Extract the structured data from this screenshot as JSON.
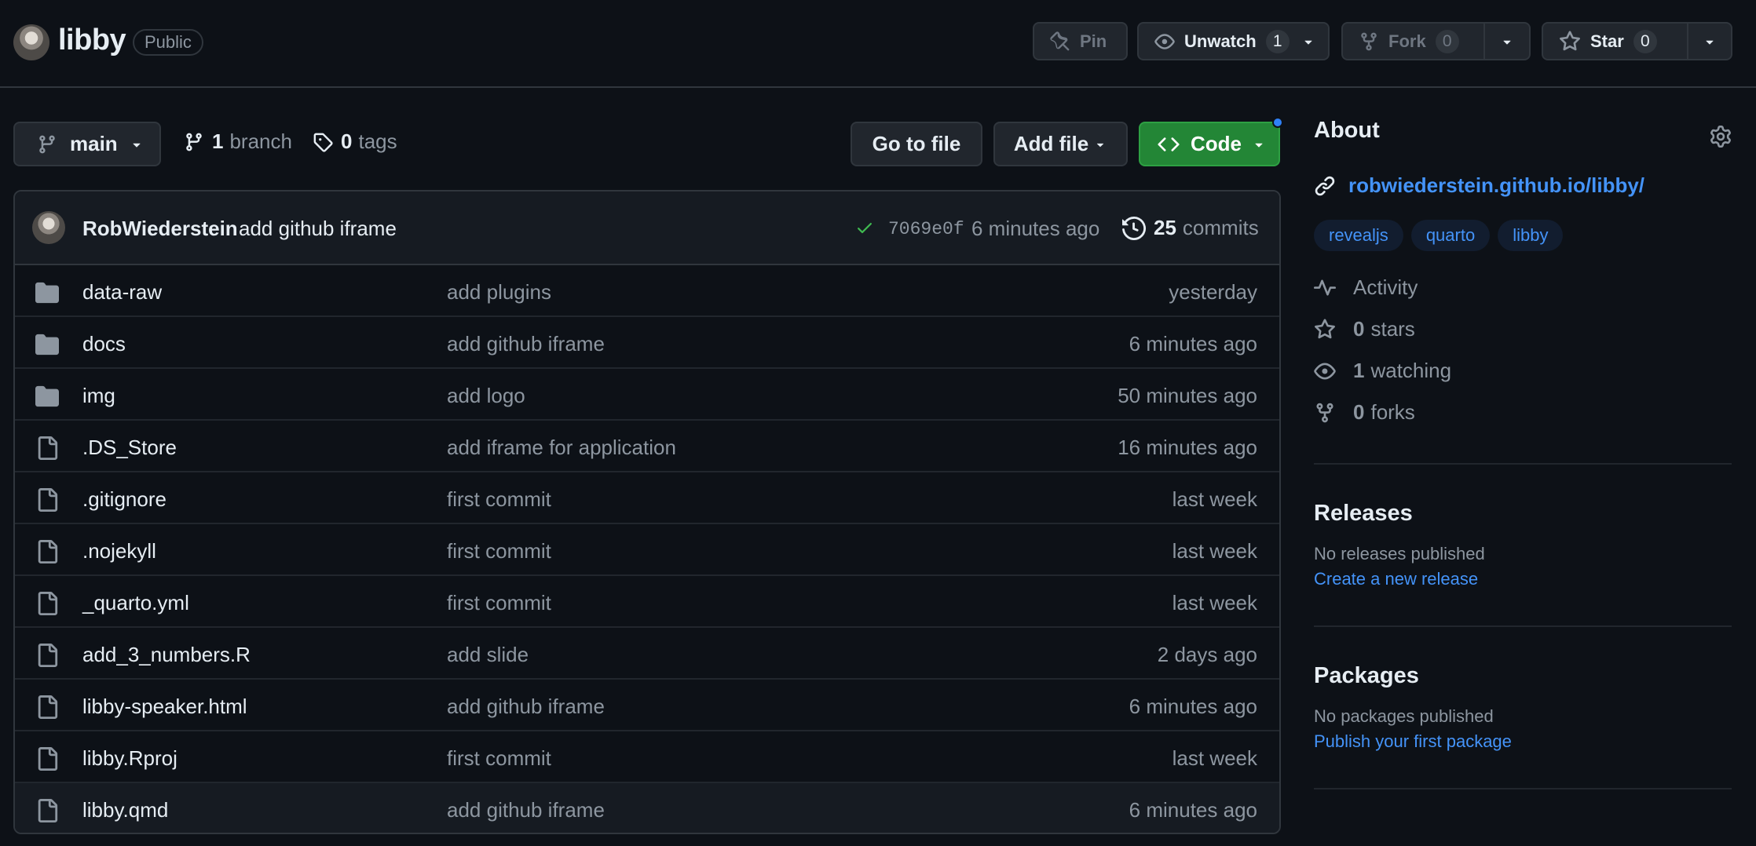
{
  "repo": {
    "name": "libby",
    "visibility": "Public"
  },
  "header_actions": {
    "pin": {
      "label": "Pin"
    },
    "unwatch": {
      "label": "Unwatch",
      "count": "1"
    },
    "fork": {
      "label": "Fork",
      "count": "0"
    },
    "star": {
      "label": "Star",
      "count": "0"
    }
  },
  "toolbar": {
    "branch": "main",
    "branch_count": "1",
    "branch_word": "branch",
    "tag_count": "0",
    "tag_word": "tags",
    "go_to_file": "Go to file",
    "add_file": "Add file",
    "code": "Code"
  },
  "latest_commit": {
    "author": "RobWiederstein",
    "message": "add github iframe",
    "sha": "7069e0f",
    "time": "6 minutes ago",
    "commit_count": "25",
    "commit_word": "commits"
  },
  "files": [
    {
      "type": "dir",
      "name": "data-raw",
      "message": "add plugins",
      "time": "yesterday"
    },
    {
      "type": "dir",
      "name": "docs",
      "message": "add github iframe",
      "time": "6 minutes ago"
    },
    {
      "type": "dir",
      "name": "img",
      "message": "add logo",
      "time": "50 minutes ago"
    },
    {
      "type": "file",
      "name": ".DS_Store",
      "message": "add iframe for application",
      "time": "16 minutes ago"
    },
    {
      "type": "file",
      "name": ".gitignore",
      "message": "first commit",
      "time": "last week"
    },
    {
      "type": "file",
      "name": ".nojekyll",
      "message": "first commit",
      "time": "last week"
    },
    {
      "type": "file",
      "name": "_quarto.yml",
      "message": "first commit",
      "time": "last week"
    },
    {
      "type": "file",
      "name": "add_3_numbers.R",
      "message": "add slide",
      "time": "2 days ago"
    },
    {
      "type": "file",
      "name": "libby-speaker.html",
      "message": "add github iframe",
      "time": "6 minutes ago"
    },
    {
      "type": "file",
      "name": "libby.Rproj",
      "message": "first commit",
      "time": "last week"
    },
    {
      "type": "file",
      "name": "libby.qmd",
      "message": "add github iframe",
      "time": "6 minutes ago"
    }
  ],
  "about": {
    "title": "About",
    "link": "robwiederstein.github.io/libby/",
    "topics": [
      "revealjs",
      "quarto",
      "libby"
    ],
    "activity": "Activity",
    "stars_count": "0",
    "stars_word": "stars",
    "watching_count": "1",
    "watching_word": "watching",
    "forks_count": "0",
    "forks_word": "forks"
  },
  "releases": {
    "title": "Releases",
    "empty": "No releases published",
    "action": "Create a new release"
  },
  "packages": {
    "title": "Packages",
    "empty": "No packages published",
    "action": "Publish your first package"
  },
  "colors": {
    "accent": "#4493f8",
    "code_button": "#238636",
    "background": "#0d1117",
    "success": "#3fb950"
  }
}
